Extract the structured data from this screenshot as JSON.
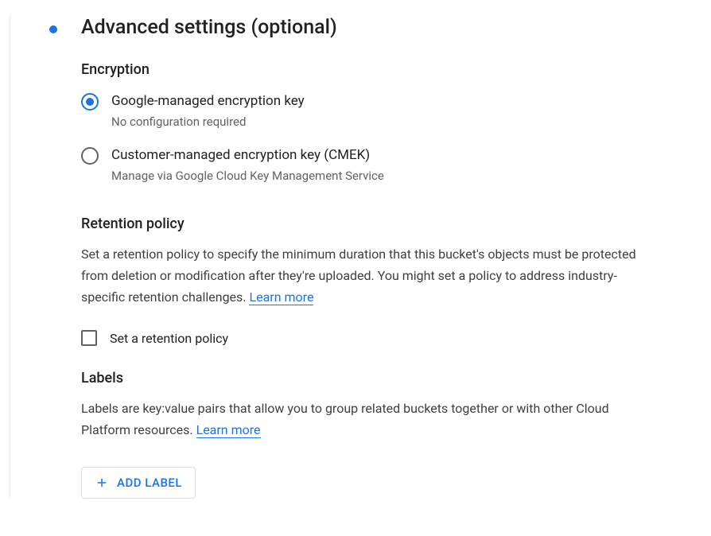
{
  "header": {
    "title": "Advanced settings (optional)"
  },
  "encryption": {
    "heading": "Encryption",
    "options": [
      {
        "label": "Google-managed encryption key",
        "sub": "No configuration required",
        "selected": true
      },
      {
        "label": "Customer-managed encryption key (CMEK)",
        "sub": "Manage via Google Cloud Key Management Service",
        "selected": false
      }
    ]
  },
  "retention": {
    "heading": "Retention policy",
    "description": "Set a retention policy to specify the minimum duration that this bucket's objects must be protected from deletion or modification after they're uploaded. You might set a policy to address industry-specific retention challenges. ",
    "learn_more": "Learn more",
    "checkbox_label": "Set a retention policy"
  },
  "labels": {
    "heading": "Labels",
    "description": "Labels are key:value pairs that allow you to group related buckets together or with other Cloud Platform resources. ",
    "learn_more": "Learn more",
    "add_button": "ADD LABEL"
  }
}
